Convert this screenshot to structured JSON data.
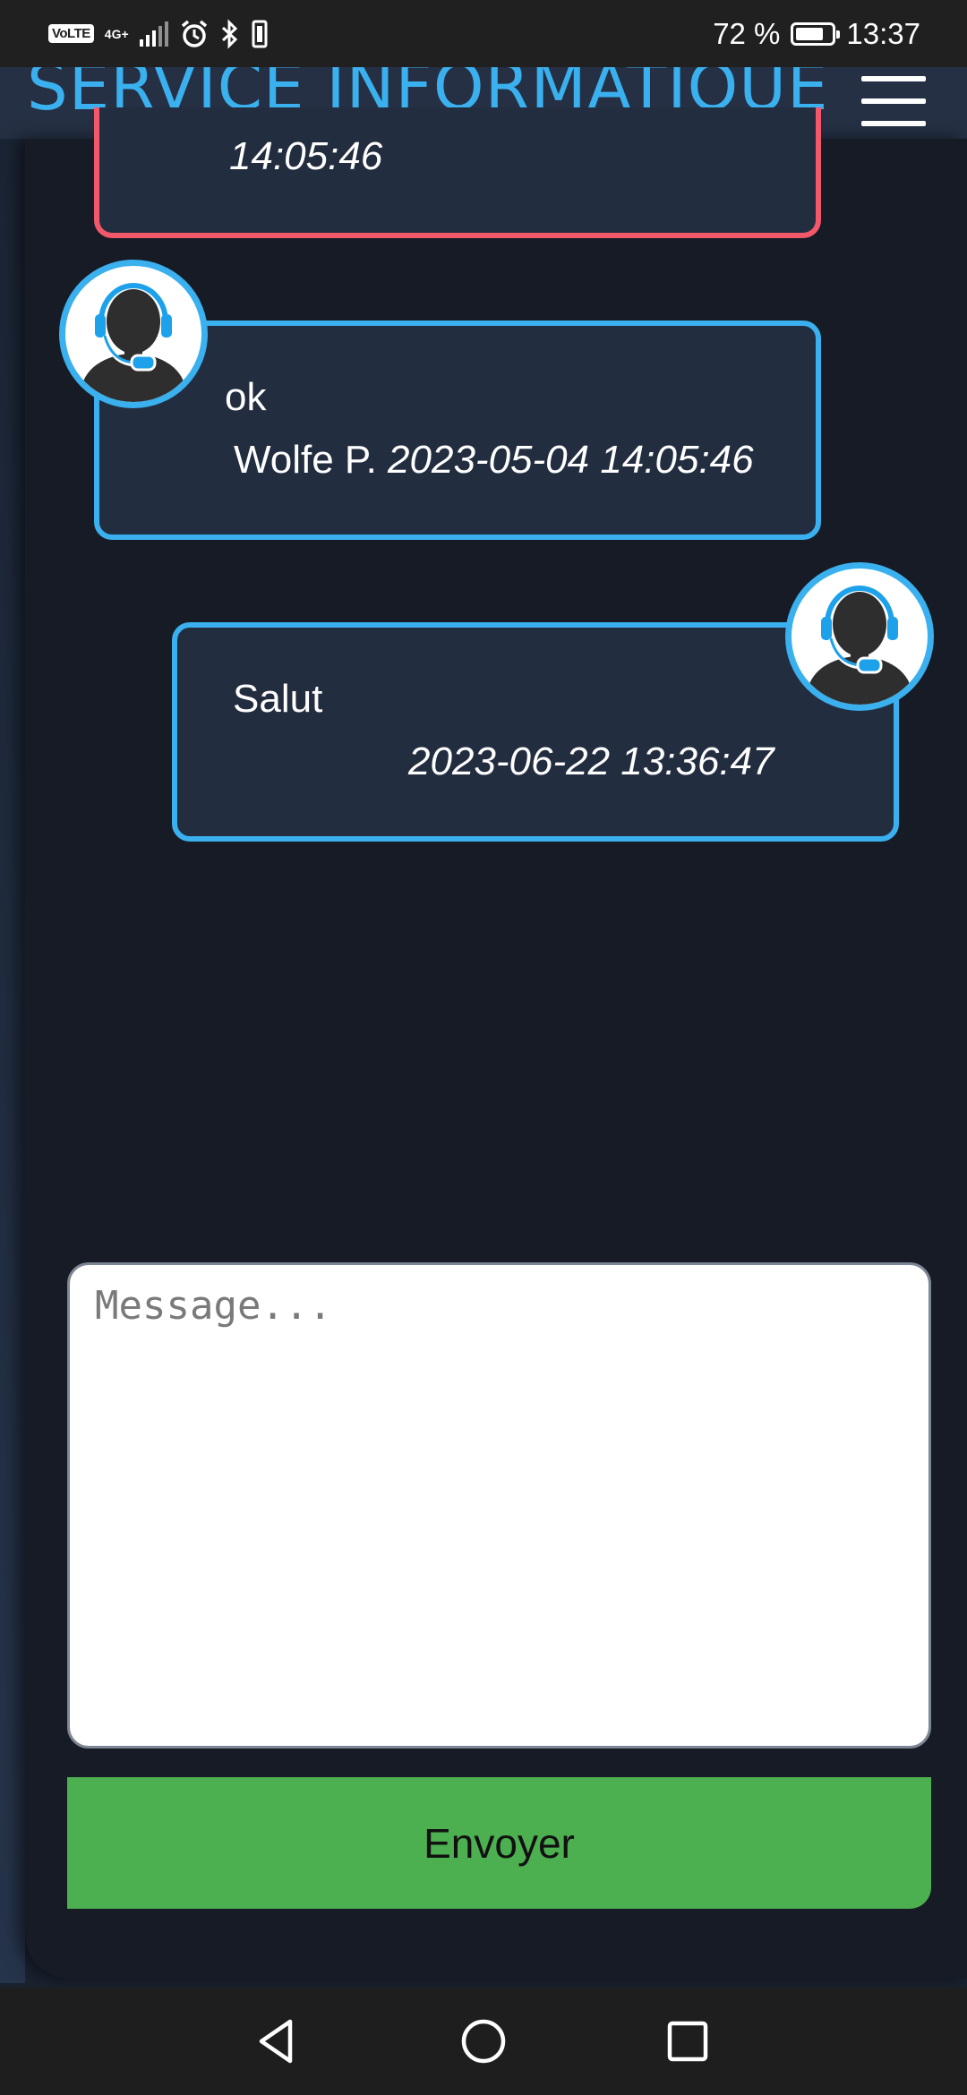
{
  "status_bar": {
    "volte": "VoLTE",
    "network": "4G+",
    "battery_percent": "72 %",
    "time": "13:37",
    "icons": [
      "volte-icon",
      "signal-icon",
      "alarm-icon",
      "bluetooth-icon",
      "vibrate-icon",
      "battery-icon"
    ]
  },
  "header": {
    "title": "SERVICE INFORMATIQUE",
    "menu_icon": "hamburger-menu-icon"
  },
  "messages": [
    {
      "text": "",
      "author": "",
      "timestamp": "14:05:46",
      "border_color": "#f2576a"
    },
    {
      "text": "ok",
      "author": "Wolfe P.",
      "timestamp": "2023-05-04 14:05:46",
      "avatar": "support-agent-icon",
      "border_color": "#3ab0ee"
    },
    {
      "text": "Salut",
      "author": "",
      "timestamp": "2023-06-22 13:36:47",
      "avatar": "support-agent-icon",
      "border_color": "#3ab0ee"
    }
  ],
  "composer": {
    "placeholder": "Message...",
    "value": "",
    "send_label": "Envoyer"
  },
  "nav_bar": {
    "icons": [
      "back-icon",
      "home-icon",
      "recents-icon"
    ]
  },
  "colors": {
    "accent": "#3ab0ee",
    "alert": "#f2576a",
    "send": "#4caf50",
    "panel_bg": "#161b25",
    "bubble_bg": "#232d40"
  }
}
